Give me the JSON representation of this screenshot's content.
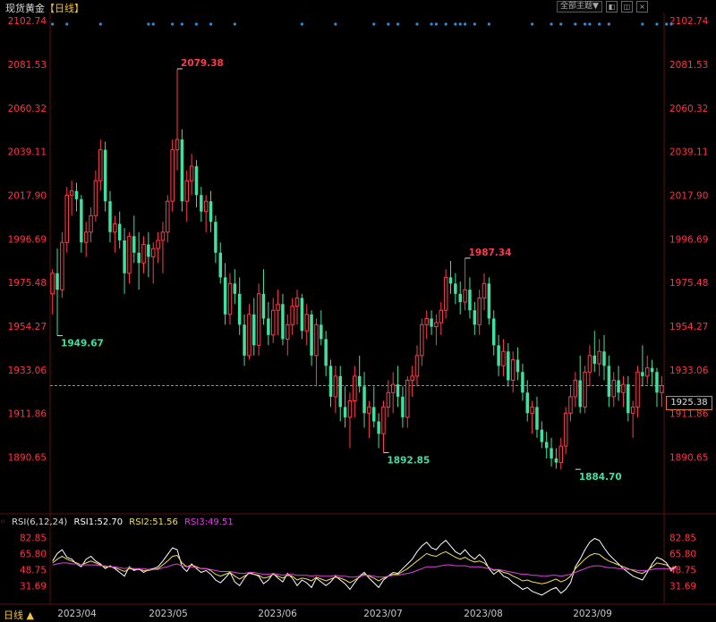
{
  "title": {
    "name": "现货黄金",
    "period": "【日线】"
  },
  "toolbar": {
    "theme_label": "全部主题▼",
    "icon_a": "◧",
    "icon_b": "◫",
    "icon_close": "×"
  },
  "bottom_left_label": "日线 ▲",
  "current_price": "1925.38",
  "rsi_header": {
    "name": "RSI(6,12,24)",
    "rsi1": "RSI1:52.70",
    "rsi2": "RSI2:51.56",
    "rsi3": "RSI3:49.51"
  },
  "colors": {
    "up": "#ff3b4a",
    "down": "#40e0a0",
    "axis_text": "#ff3344",
    "rsi1": "#ffffff",
    "rsi2": "#f0e060",
    "rsi3": "#e040e0",
    "current_line": "#e07a3a",
    "event_dot": "#2a8fd8"
  },
  "chart_data": [
    {
      "type": "candlestick",
      "ylim": [
        1880,
        2105
      ],
      "y_ticks": [
        2102.74,
        2081.53,
        2060.32,
        2039.11,
        2017.9,
        1996.69,
        1975.48,
        1954.27,
        1933.06,
        1911.86,
        1890.65
      ],
      "x_ticks": [
        "2023/04",
        "2023/05",
        "2023/06",
        "2023/07",
        "2023/08",
        "2023/09"
      ],
      "annotations": [
        {
          "label": "2079.38",
          "value": 2079.38,
          "index": 26,
          "kind": "high"
        },
        {
          "label": "1949.67",
          "value": 1949.67,
          "index": 1,
          "kind": "low"
        },
        {
          "label": "1892.85",
          "value": 1892.85,
          "index": 69,
          "kind": "low"
        },
        {
          "label": "1987.34",
          "value": 1987.34,
          "index": 86,
          "kind": "high"
        },
        {
          "label": "1884.70",
          "value": 1884.7,
          "index": 109,
          "kind": "low"
        }
      ],
      "current_price": 1925.38,
      "candles": [
        [
          1970,
          1982,
          1960,
          1980
        ],
        [
          1980,
          1992,
          1949.67,
          1972
        ],
        [
          1972,
          2000,
          1968,
          1995
        ],
        [
          1995,
          2022,
          1990,
          2018
        ],
        [
          2018,
          2025,
          2008,
          2020
        ],
        [
          2020,
          2024,
          2010,
          2016
        ],
        [
          2016,
          2018,
          1990,
          1995
        ],
        [
          1995,
          2005,
          1988,
          2000
        ],
        [
          2000,
          2012,
          1995,
          2008
        ],
        [
          2008,
          2030,
          2005,
          2025
        ],
        [
          2025,
          2045,
          2020,
          2040
        ],
        [
          2040,
          2044,
          2010,
          2015
        ],
        [
          2015,
          2020,
          1995,
          2000
        ],
        [
          2000,
          2008,
          1990,
          2004
        ],
        [
          2004,
          2010,
          1992,
          1996
        ],
        [
          1996,
          2002,
          1970,
          1980
        ],
        [
          1980,
          2000,
          1975,
          1998
        ],
        [
          1998,
          2008,
          1985,
          1990
        ],
        [
          1990,
          2000,
          1972,
          1985
        ],
        [
          1985,
          1998,
          1980,
          1994
        ],
        [
          1994,
          2000,
          1978,
          1988
        ],
        [
          1988,
          1995,
          1975,
          1992
        ],
        [
          1992,
          2000,
          1985,
          1996
        ],
        [
          1996,
          2005,
          1980,
          2000
        ],
        [
          2000,
          2018,
          1995,
          2015
        ],
        [
          2015,
          2045,
          2010,
          2040
        ],
        [
          2040,
          2079.38,
          2030,
          2045
        ],
        [
          2045,
          2050,
          2010,
          2015
        ],
        [
          2015,
          2030,
          2005,
          2025
        ],
        [
          2025,
          2038,
          2018,
          2032
        ],
        [
          2032,
          2035,
          2012,
          2018
        ],
        [
          2018,
          2022,
          2005,
          2010
        ],
        [
          2010,
          2018,
          2000,
          2015
        ],
        [
          2015,
          2020,
          2000,
          2005
        ],
        [
          2005,
          2008,
          1985,
          1990
        ],
        [
          1990,
          1995,
          1975,
          1978
        ],
        [
          1978,
          1985,
          1955,
          1960
        ],
        [
          1960,
          1980,
          1955,
          1975
        ],
        [
          1975,
          1982,
          1965,
          1970
        ],
        [
          1970,
          1978,
          1950,
          1955
        ],
        [
          1955,
          1960,
          1935,
          1940
        ],
        [
          1940,
          1965,
          1938,
          1960
        ],
        [
          1960,
          1968,
          1940,
          1945
        ],
        [
          1945,
          1975,
          1940,
          1970
        ],
        [
          1970,
          1982,
          1955,
          1958
        ],
        [
          1958,
          1966,
          1945,
          1950
        ],
        [
          1950,
          1968,
          1946,
          1962
        ],
        [
          1962,
          1972,
          1950,
          1965
        ],
        [
          1965,
          1970,
          1945,
          1948
        ],
        [
          1948,
          1960,
          1940,
          1955
        ],
        [
          1955,
          1968,
          1950,
          1964
        ],
        [
          1964,
          1972,
          1955,
          1968
        ],
        [
          1968,
          1970,
          1948,
          1952
        ],
        [
          1952,
          1965,
          1945,
          1960
        ],
        [
          1960,
          1962,
          1935,
          1940
        ],
        [
          1940,
          1958,
          1925,
          1955
        ],
        [
          1955,
          1962,
          1945,
          1948
        ],
        [
          1948,
          1952,
          1930,
          1935
        ],
        [
          1935,
          1938,
          1915,
          1920
        ],
        [
          1920,
          1935,
          1912,
          1930
        ],
        [
          1930,
          1935,
          1908,
          1915
        ],
        [
          1915,
          1925,
          1905,
          1910
        ],
        [
          1910,
          1922,
          1895,
          1918
        ],
        [
          1918,
          1935,
          1910,
          1930
        ],
        [
          1930,
          1940,
          1922,
          1925
        ],
        [
          1925,
          1932,
          1905,
          1912
        ],
        [
          1912,
          1918,
          1900,
          1915
        ],
        [
          1915,
          1925,
          1905,
          1908
        ],
        [
          1908,
          1912,
          1895,
          1902
        ],
        [
          1902,
          1918,
          1892.85,
          1915
        ],
        [
          1915,
          1928,
          1910,
          1922
        ],
        [
          1922,
          1932,
          1912,
          1926
        ],
        [
          1926,
          1935,
          1915,
          1920
        ],
        [
          1920,
          1925,
          1905,
          1910
        ],
        [
          1910,
          1930,
          1905,
          1928
        ],
        [
          1928,
          1935,
          1920,
          1930
        ],
        [
          1930,
          1945,
          1925,
          1940
        ],
        [
          1940,
          1958,
          1935,
          1955
        ],
        [
          1955,
          1962,
          1948,
          1958
        ],
        [
          1958,
          1962,
          1950,
          1954
        ],
        [
          1954,
          1960,
          1945,
          1956
        ],
        [
          1956,
          1966,
          1950,
          1962
        ],
        [
          1962,
          1982,
          1958,
          1978
        ],
        [
          1978,
          1986,
          1970,
          1975
        ],
        [
          1975,
          1980,
          1965,
          1970
        ],
        [
          1970,
          1976,
          1960,
          1966
        ],
        [
          1966,
          1987.34,
          1962,
          1972
        ],
        [
          1972,
          1978,
          1958,
          1962
        ],
        [
          1962,
          1966,
          1950,
          1955
        ],
        [
          1955,
          1972,
          1950,
          1968
        ],
        [
          1968,
          1980,
          1962,
          1975
        ],
        [
          1975,
          1978,
          1955,
          1958
        ],
        [
          1958,
          1962,
          1940,
          1945
        ],
        [
          1945,
          1950,
          1930,
          1935
        ],
        [
          1935,
          1948,
          1930,
          1942
        ],
        [
          1942,
          1946,
          1925,
          1928
        ],
        [
          1928,
          1942,
          1922,
          1938
        ],
        [
          1938,
          1944,
          1928,
          1932
        ],
        [
          1932,
          1936,
          1918,
          1922
        ],
        [
          1922,
          1928,
          1908,
          1912
        ],
        [
          1912,
          1918,
          1902,
          1915
        ],
        [
          1915,
          1920,
          1900,
          1904
        ],
        [
          1904,
          1908,
          1895,
          1898
        ],
        [
          1898,
          1903,
          1890,
          1895
        ],
        [
          1895,
          1900,
          1886,
          1890
        ],
        [
          1890,
          1895,
          1885,
          1888
        ],
        [
          1888,
          1900,
          1884.7,
          1896
        ],
        [
          1896,
          1915,
          1892,
          1912
        ],
        [
          1912,
          1925,
          1908,
          1920
        ],
        [
          1920,
          1932,
          1915,
          1928
        ],
        [
          1928,
          1940,
          1912,
          1915
        ],
        [
          1915,
          1935,
          1912,
          1932
        ],
        [
          1932,
          1945,
          1925,
          1940
        ],
        [
          1940,
          1952,
          1932,
          1936
        ],
        [
          1936,
          1948,
          1930,
          1942
        ],
        [
          1942,
          1950,
          1928,
          1935
        ],
        [
          1935,
          1940,
          1915,
          1920
        ],
        [
          1920,
          1932,
          1915,
          1928
        ],
        [
          1928,
          1935,
          1918,
          1922
        ],
        [
          1922,
          1930,
          1915,
          1926
        ],
        [
          1926,
          1930,
          1908,
          1912
        ],
        [
          1912,
          1918,
          1900,
          1915
        ],
        [
          1915,
          1935,
          1910,
          1932
        ],
        [
          1932,
          1945,
          1925,
          1930
        ],
        [
          1930,
          1940,
          1926,
          1934
        ],
        [
          1934,
          1938,
          1925,
          1932
        ],
        [
          1932,
          1934,
          1915,
          1922
        ],
        [
          1922,
          1930,
          1915,
          1925.38
        ]
      ],
      "event_dot_indices": [
        0,
        3,
        10,
        20,
        21,
        25,
        27,
        30,
        33,
        38,
        52,
        59,
        67,
        70,
        72,
        76,
        79,
        80,
        82,
        84,
        85,
        86,
        88,
        91,
        100,
        104,
        106,
        109,
        111,
        112,
        114,
        116,
        123,
        126,
        128,
        129
      ]
    },
    {
      "type": "line",
      "name": "RSI",
      "ylim": [
        20,
        90
      ],
      "y_ticks": [
        82.85,
        65.8,
        48.75,
        31.69
      ],
      "series": [
        {
          "name": "RSI1",
          "values": [
            58,
            66,
            70,
            62,
            60,
            55,
            52,
            60,
            63,
            58,
            55,
            50,
            53,
            50,
            46,
            42,
            52,
            48,
            50,
            46,
            49,
            50,
            52,
            58,
            65,
            72,
            70,
            52,
            47,
            55,
            50,
            46,
            48,
            44,
            38,
            35,
            40,
            46,
            36,
            32,
            40,
            46,
            44,
            42,
            34,
            38,
            45,
            40,
            36,
            45,
            40,
            32,
            38,
            35,
            30,
            40,
            36,
            32,
            36,
            42,
            38,
            34,
            28,
            35,
            42,
            46,
            40,
            35,
            30,
            38,
            42,
            46,
            45,
            50,
            55,
            60,
            68,
            74,
            78,
            72,
            70,
            76,
            80,
            74,
            68,
            65,
            70,
            64,
            60,
            65,
            60,
            50,
            44,
            48,
            42,
            40,
            35,
            32,
            28,
            30,
            26,
            24,
            22,
            25,
            28,
            30,
            24,
            28,
            35,
            52,
            60,
            70,
            78,
            82,
            80,
            72,
            65,
            60,
            55,
            50,
            46,
            42,
            40,
            38,
            46,
            55,
            62,
            60,
            56,
            48,
            52.7
          ]
        },
        {
          "name": "RSI2",
          "values": [
            56,
            60,
            63,
            60,
            58,
            56,
            54,
            56,
            58,
            56,
            54,
            52,
            52,
            51,
            49,
            47,
            50,
            49,
            49,
            48,
            48,
            49,
            50,
            54,
            58,
            63,
            64,
            56,
            52,
            54,
            52,
            50,
            50,
            48,
            44,
            42,
            44,
            46,
            42,
            39,
            42,
            45,
            44,
            43,
            40,
            41,
            44,
            42,
            40,
            43,
            42,
            38,
            40,
            39,
            37,
            41,
            39,
            37,
            39,
            41,
            40,
            38,
            35,
            38,
            41,
            44,
            42,
            40,
            37,
            40,
            42,
            44,
            44,
            47,
            50,
            54,
            58,
            62,
            66,
            64,
            63,
            66,
            68,
            65,
            62,
            60,
            62,
            59,
            57,
            58,
            56,
            51,
            48,
            49,
            46,
            45,
            42,
            40,
            37,
            38,
            36,
            35,
            34,
            35,
            37,
            39,
            36,
            38,
            42,
            50,
            55,
            60,
            64,
            66,
            65,
            61,
            58,
            56,
            54,
            52,
            50,
            48,
            46,
            45,
            48,
            52,
            56,
            55,
            54,
            50,
            51.56
          ]
        },
        {
          "name": "RSI3",
          "values": [
            54,
            55,
            56,
            56,
            55,
            55,
            54,
            54,
            54,
            54,
            53,
            53,
            52,
            52,
            51,
            50,
            51,
            50,
            50,
            50,
            49,
            49,
            49,
            51,
            52,
            54,
            55,
            53,
            52,
            52,
            51,
            50,
            50,
            49,
            48,
            47,
            47,
            47,
            46,
            45,
            45,
            46,
            46,
            45,
            44,
            44,
            45,
            44,
            43,
            44,
            44,
            43,
            43,
            43,
            42,
            43,
            42,
            42,
            42,
            43,
            42,
            42,
            41,
            41,
            42,
            43,
            43,
            42,
            41,
            41,
            42,
            43,
            43,
            44,
            45,
            46,
            48,
            50,
            52,
            52,
            52,
            53,
            54,
            54,
            53,
            53,
            53,
            52,
            52,
            52,
            51,
            50,
            49,
            49,
            48,
            47,
            46,
            45,
            44,
            44,
            43,
            43,
            42,
            42,
            43,
            43,
            42,
            43,
            44,
            46,
            48,
            50,
            52,
            53,
            53,
            52,
            51,
            51,
            50,
            50,
            49,
            49,
            48,
            48,
            48,
            49,
            50,
            50,
            50,
            49,
            49.51
          ]
        }
      ]
    }
  ]
}
